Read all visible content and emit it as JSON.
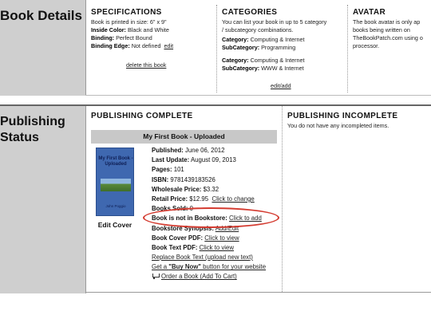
{
  "book_details": {
    "label": "Book Details",
    "specifications": {
      "title": "SPECIFICATIONS",
      "size": "Book is printed in size: 6\" x 9\"",
      "inside_color_label": "Inside Color:",
      "inside_color": "Black and White",
      "binding_label": "Binding:",
      "binding": "Perfect Bound",
      "binding_edge_label": "Binding Edge:",
      "binding_edge": "Not defined",
      "edit_link": "edit",
      "delete_link": "delete this book"
    },
    "categories": {
      "title": "CATEGORIES",
      "desc_line1": "You can list your book in up to 5 category",
      "desc_line2": "/ subcategory combinations.",
      "entries": [
        {
          "cat_label": "Category:",
          "cat": "Computing & Internet",
          "sub_label": "SubCategory:",
          "sub": "Programming"
        },
        {
          "cat_label": "Category:",
          "cat": "Computing & Internet",
          "sub_label": "SubCategory:",
          "sub": "WWW & Internet"
        }
      ],
      "edit_add_link": "edit/add"
    },
    "avatar": {
      "title": "AVATAR",
      "line1": "The book avatar is only ap",
      "line2": "books being written on",
      "line3": "TheBookPatch.com using o",
      "line4": "processor."
    }
  },
  "publishing_status": {
    "label_line1": "Publishing",
    "label_line2": "Status",
    "complete": {
      "title": "PUBLISHING COMPLETE",
      "book_bar": "My First Book - Uploaded",
      "cover_title": "My First Book - Uploaded",
      "cover_author": "John Poggio",
      "edit_cover": "Edit Cover",
      "published_label": "Published:",
      "published": "June 06, 2012",
      "last_update_label": "Last Update:",
      "last_update": "August 09, 2013",
      "pages_label": "Pages:",
      "pages": "101",
      "isbn_label": "ISBN:",
      "isbn": "9781439183526",
      "wholesale_label": "Wholesale Price:",
      "wholesale": "$3.32",
      "retail_label": "Retail Price:",
      "retail": "$12.95",
      "retail_change_link": "Click to change",
      "books_sold_label": "Books Sold:",
      "books_sold": "0",
      "bookstore_label": "Book is not in Bookstore:",
      "bookstore_add_link": "Click to add",
      "synopsis_label": "Bookstore Synopsis:",
      "synopsis_link": "Add/Edit",
      "cover_pdf_label": "Book Cover PDF:",
      "cover_pdf_link": "Click to view",
      "text_pdf_label": "Book Text PDF:",
      "text_pdf_link": "Click to view",
      "replace_text_link": "Replace Book Text (upload new text)",
      "buy_now_pre": "Get a ",
      "buy_now_quote": "\"Buy Now\"",
      "buy_now_post": " button for your website",
      "order_link": "Order a Book (Add To Cart)"
    },
    "incomplete": {
      "title": "PUBLISHING INCOMPLETE",
      "message": "You do not have any incompleted items."
    }
  },
  "colors": {
    "label_bg": "#cfcfcf",
    "highlight_ring": "#d43b30",
    "cover_blue": "#3f68b0"
  }
}
